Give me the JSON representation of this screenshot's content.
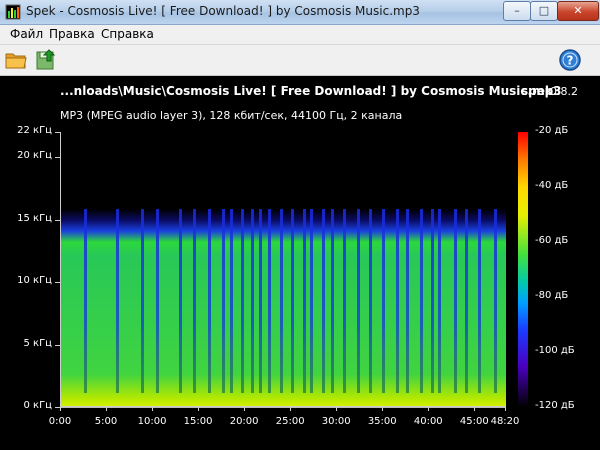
{
  "window": {
    "title": "Spek - Cosmosis Live! [ Free Download! ] by Cosmosis Music.mp3",
    "min_glyph": "–",
    "max_glyph": "□",
    "close_glyph": "✕"
  },
  "menu": {
    "items": [
      {
        "label": "Файл"
      },
      {
        "label": "Правка"
      },
      {
        "label": "Справка"
      }
    ]
  },
  "toolbar": {
    "open_icon": "folder-open-icon",
    "save_icon": "save-icon",
    "help_icon": "help-icon"
  },
  "spectrogram": {
    "file_title": "...nloads\\Music\\Cosmosis Live! [ Free Download! ] by Cosmosis Music.mp3",
    "app_name": "spek",
    "app_version": "0.8.2",
    "stream_info": "MP3 (MPEG audio layer 3), 128 кбит/сек, 44100 Гц, 2 канала",
    "frequency_axis": {
      "max_khz": 22,
      "ticks": [
        {
          "value": 0,
          "label": "0 кГц"
        },
        {
          "value": 5,
          "label": "5 кГц"
        },
        {
          "value": 10,
          "label": "10 кГц"
        },
        {
          "value": 15,
          "label": "15 кГц"
        },
        {
          "value": 20,
          "label": "20 кГц"
        },
        {
          "value": 22,
          "label": "22 кГц"
        }
      ]
    },
    "time_axis": {
      "total_seconds": 2900,
      "ticks": [
        {
          "value": 0,
          "label": "0:00"
        },
        {
          "value": 300,
          "label": "5:00"
        },
        {
          "value": 600,
          "label": "10:00"
        },
        {
          "value": 900,
          "label": "15:00"
        },
        {
          "value": 1200,
          "label": "20:00"
        },
        {
          "value": 1500,
          "label": "25:00"
        },
        {
          "value": 1800,
          "label": "30:00"
        },
        {
          "value": 2100,
          "label": "35:00"
        },
        {
          "value": 2400,
          "label": "40:00"
        },
        {
          "value": 2700,
          "label": "45:00"
        },
        {
          "value": 2900,
          "label": "48:20"
        }
      ]
    },
    "db_scale": {
      "min_db": -120,
      "max_db": -20,
      "ticks": [
        {
          "value": -20,
          "label": "-20 дБ"
        },
        {
          "value": -40,
          "label": "-40 дБ"
        },
        {
          "value": -60,
          "label": "-60 дБ"
        },
        {
          "value": -80,
          "label": "-80 дБ"
        },
        {
          "value": -100,
          "label": "-100 дБ"
        },
        {
          "value": -120,
          "label": "-120 дБ"
        }
      ]
    },
    "cutoff_khz": 16,
    "dips_seconds": [
      150,
      360,
      520,
      620,
      770,
      860,
      960,
      1050,
      1100,
      1170,
      1240,
      1290,
      1350,
      1430,
      1500,
      1580,
      1620,
      1700,
      1760,
      1840,
      1930,
      2010,
      2090,
      2180,
      2250,
      2340,
      2410,
      2460,
      2560,
      2630,
      2720,
      2820
    ]
  }
}
